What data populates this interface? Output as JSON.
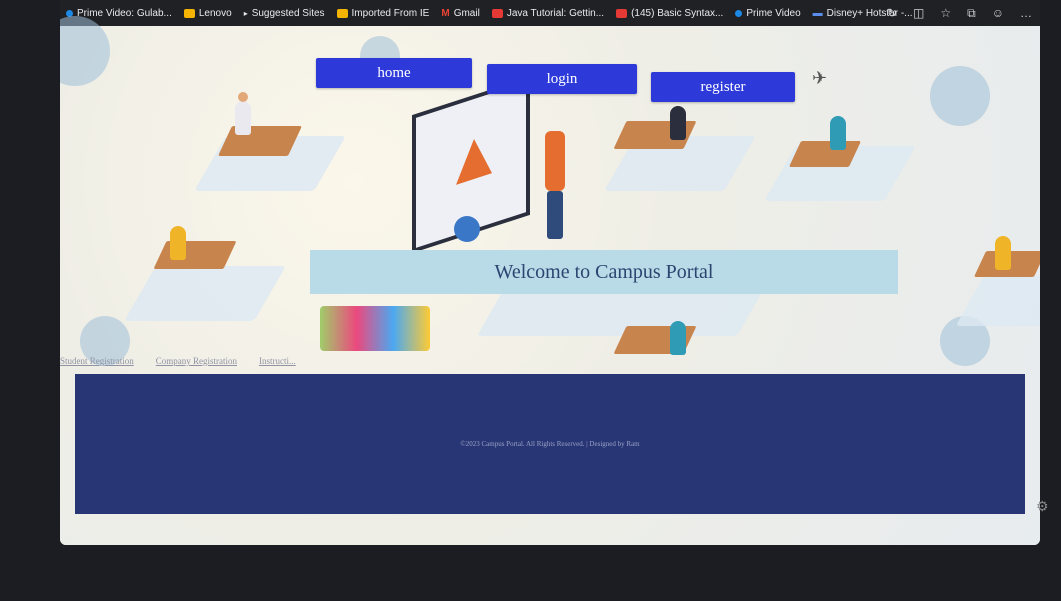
{
  "bookmarks": [
    {
      "label": "Prime Video: Gulab...",
      "icon": "prime-video-icon"
    },
    {
      "label": "Lenovo",
      "icon": "folder-icon"
    },
    {
      "label": "Suggested Sites",
      "icon": "suggested-sites-icon"
    },
    {
      "label": "Imported From IE",
      "icon": "folder-icon"
    },
    {
      "label": "Gmail",
      "icon": "gmail-icon"
    },
    {
      "label": "Java Tutorial: Gettin...",
      "icon": "youtube-icon"
    },
    {
      "label": "(145) Basic Syntax...",
      "icon": "youtube-icon"
    },
    {
      "label": "Prime Video",
      "icon": "prime-video-icon"
    },
    {
      "label": "Disney+ Hotstar -...",
      "icon": "hotstar-icon"
    }
  ],
  "nav": {
    "home": "home",
    "login": "login",
    "register": "register"
  },
  "hero": {
    "welcome": "Welcome to Campus Portal"
  },
  "links": [
    "Student Registration",
    "Company Registration",
    "Instructi..."
  ],
  "footer": {
    "text": "©2023 Campus Portal. All Rights Reserved. | Designed by Ram"
  },
  "colors": {
    "nav": "#2d3ad9",
    "footer": "#283675",
    "welcome_bg": "#b9dbe8"
  }
}
